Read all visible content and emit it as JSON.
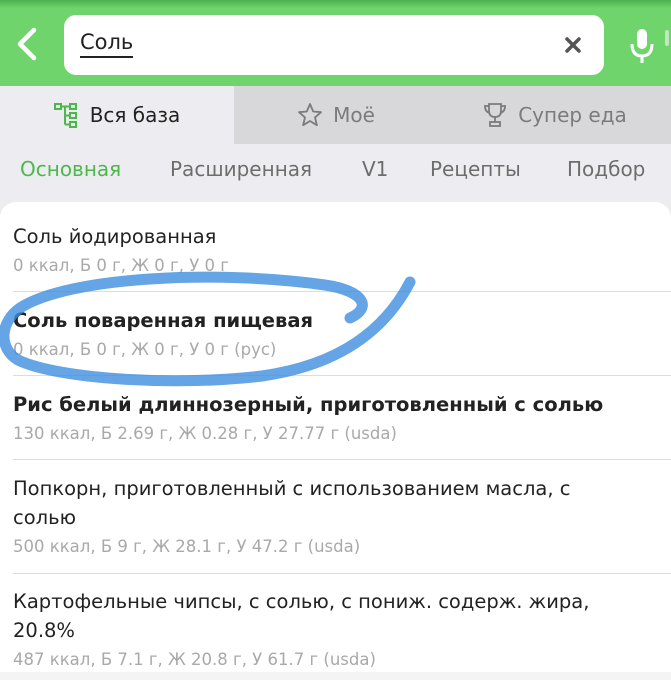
{
  "search": {
    "query": "Соль"
  },
  "source_tabs": [
    {
      "label": "Вся база",
      "icon": "tree-icon",
      "active": true
    },
    {
      "label": "Моё",
      "icon": "star-icon",
      "active": false
    },
    {
      "label": "Супер еда",
      "icon": "trophy-icon",
      "active": false
    }
  ],
  "category_tabs": [
    {
      "label": "Основная",
      "active": true
    },
    {
      "label": "Расширенная",
      "active": false
    },
    {
      "label": "V1",
      "active": false
    },
    {
      "label": "Рецепты",
      "active": false
    },
    {
      "label": "Подбор",
      "active": false
    }
  ],
  "results": [
    {
      "name": "Соль йодированная",
      "info": "0 ккал, Б 0 г, Ж 0 г, У 0 г",
      "bold": false
    },
    {
      "name": "Соль поваренная пищевая",
      "info": "0 ккал, Б 0 г, Ж 0 г, У 0 г (рус)",
      "bold": true
    },
    {
      "name": "Рис белый длиннозерный, приготовленный с солью",
      "info": "130 ккал, Б 2.69 г, Ж 0.28 г, У 27.77 г (usda)",
      "bold": true
    },
    {
      "name": "Попкорн, приготовленный с использованием масла, с солью",
      "info": "500 ккал, Б 9 г, Ж 28.1 г, У 47.2 г (usda)",
      "bold": false
    },
    {
      "name": "Картофельные чипсы, с солью, с пониж. содерж. жира, 20.8%",
      "info": "487 ккал, Б 7.1 г, Ж 20.8 г, У 61.7 г (usda)",
      "bold": false
    }
  ],
  "colors": {
    "header_green": "#6fd46c",
    "accent_green": "#4cb84c",
    "highlight_marker": "#3f8fe0"
  }
}
